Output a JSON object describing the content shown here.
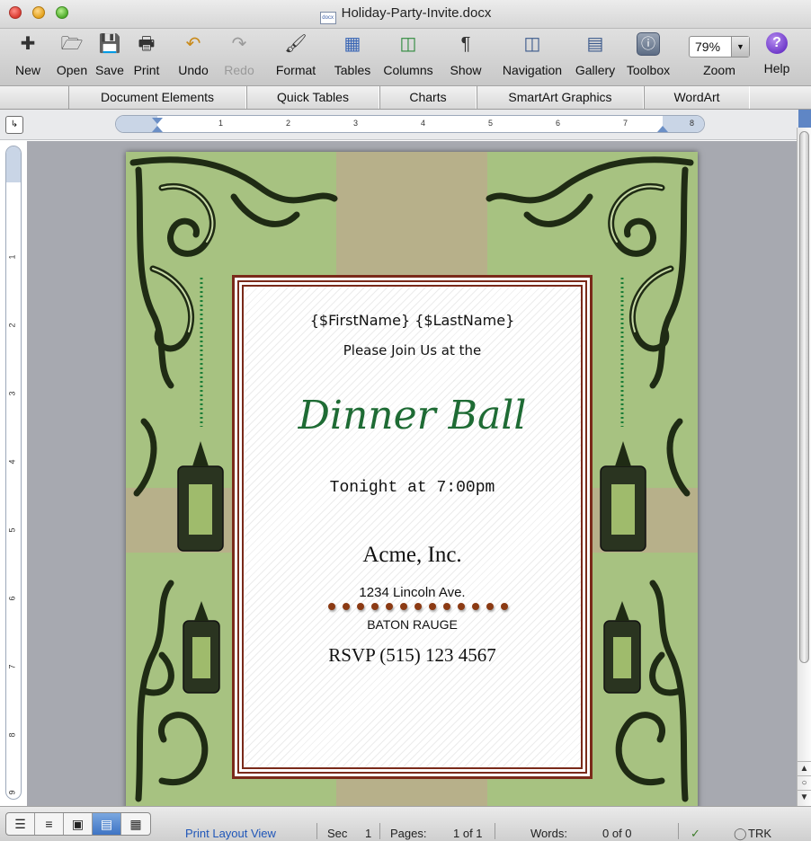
{
  "window": {
    "title": "Holiday-Party-Invite.docx",
    "doc_badge": "docx"
  },
  "toolbar": {
    "new": "New",
    "open": "Open",
    "save": "Save",
    "print": "Print",
    "undo": "Undo",
    "redo": "Redo",
    "format": "Format",
    "tables": "Tables",
    "columns": "Columns",
    "show": "Show",
    "navigation": "Navigation",
    "gallery": "Gallery",
    "toolbox": "Toolbox",
    "zoom_label": "Zoom",
    "zoom_value": "79%",
    "help": "Help"
  },
  "ribbon": {
    "tabs": [
      "Document Elements",
      "Quick Tables",
      "Charts",
      "SmartArt Graphics",
      "WordArt"
    ]
  },
  "ruler": {
    "h_numbers": [
      "1",
      "2",
      "3",
      "4",
      "5",
      "6",
      "7",
      "8"
    ],
    "v_numbers": [
      "1",
      "2",
      "3",
      "4",
      "5",
      "6",
      "7",
      "8",
      "9"
    ]
  },
  "invite": {
    "names": "{$FirstName} {$LastName}",
    "join_line": "Please Join Us at the",
    "event": "Dinner Ball",
    "time": "Tonight at 7:00pm",
    "company": "Acme, Inc.",
    "street": "1234 Lincoln Ave.",
    "city": "BATON RAUGE",
    "rsvp": "RSVP (515) 123 4567"
  },
  "colors": {
    "page_green": "#a7c281",
    "band_tan": "#b7b08a",
    "frame_brown": "#7a2a1a",
    "event_green": "#1e6b34",
    "dot_brown": "#8b3a13"
  },
  "status": {
    "view": "Print Layout View",
    "sec_label": "Sec",
    "sec_value": "1",
    "pages_label": "Pages:",
    "pages_value": "1 of 1",
    "words_label": "Words:",
    "words_value": "0 of 0",
    "trk": "TRK"
  }
}
